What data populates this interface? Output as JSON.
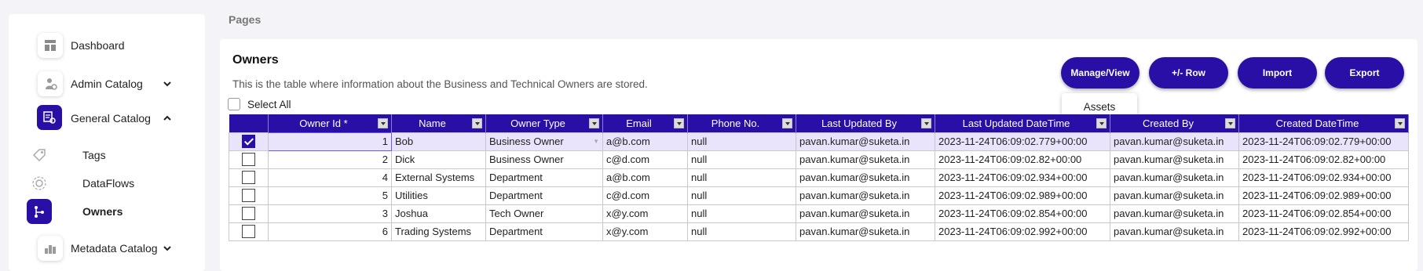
{
  "sidebar": {
    "items": [
      {
        "label": "Dashboard",
        "icon": "dashboard-icon"
      },
      {
        "label": "Admin Catalog",
        "icon": "admin-catalog-icon",
        "expand": "chevron-down-icon"
      },
      {
        "label": "General Catalog",
        "icon": "general-catalog-icon",
        "expand": "chevron-up-icon",
        "active": true
      },
      {
        "label": "Tags",
        "icon": "tag-icon"
      },
      {
        "label": "DataFlows",
        "icon": "dataflows-icon"
      },
      {
        "label": "Owners",
        "icon": "owners-icon",
        "active": true
      },
      {
        "label": "Metadata Catalog",
        "icon": "metadata-catalog-icon",
        "expand": "chevron-down-icon"
      }
    ]
  },
  "breadcrumb": "Pages",
  "page": {
    "title": "Owners",
    "description": "This is the table where information about the Business and Technical Owners are stored."
  },
  "toolbar": {
    "manage_view": "Manage/View",
    "row": "+/- Row",
    "import": "Import",
    "export": "Export",
    "dropdown_item": "Assets"
  },
  "select_all": "Select All",
  "table": {
    "columns": [
      "Owner Id *",
      "Name",
      "Owner Type",
      "Email",
      "Phone No.",
      "Last Updated By",
      "Last Updated DateTime",
      "Created By",
      "Created DateTime"
    ],
    "rows": [
      {
        "checked": true,
        "id": "1",
        "name": "Bob",
        "type": "Business Owner",
        "email": "a@b.com",
        "phone": "null",
        "updated_by": "pavan.kumar@suketa.in",
        "updated_at": "2023-11-24T06:09:02.779+00:00",
        "created_by": "pavan.kumar@suketa.in",
        "created_at": "2023-11-24T06:09:02.779+00:00"
      },
      {
        "checked": false,
        "id": "2",
        "name": "Dick",
        "type": "Business Owner",
        "email": "c@d.com",
        "phone": "null",
        "updated_by": "pavan.kumar@suketa.in",
        "updated_at": "2023-11-24T06:09:02.82+00:00",
        "created_by": "pavan.kumar@suketa.in",
        "created_at": "2023-11-24T06:09:02.82+00:00"
      },
      {
        "checked": false,
        "id": "4",
        "name": "External Systems",
        "type": "Department",
        "email": "a@b.com",
        "phone": "null",
        "updated_by": "pavan.kumar@suketa.in",
        "updated_at": "2023-11-24T06:09:02.934+00:00",
        "created_by": "pavan.kumar@suketa.in",
        "created_at": "2023-11-24T06:09:02.934+00:00"
      },
      {
        "checked": false,
        "id": "5",
        "name": "Utilities",
        "type": "Department",
        "email": "c@d.com",
        "phone": "null",
        "updated_by": "pavan.kumar@suketa.in",
        "updated_at": "2023-11-24T06:09:02.989+00:00",
        "created_by": "pavan.kumar@suketa.in",
        "created_at": "2023-11-24T06:09:02.989+00:00"
      },
      {
        "checked": false,
        "id": "3",
        "name": "Joshua",
        "type": "Tech Owner",
        "email": "x@y.com",
        "phone": "null",
        "updated_by": "pavan.kumar@suketa.in",
        "updated_at": "2023-11-24T06:09:02.854+00:00",
        "created_by": "pavan.kumar@suketa.in",
        "created_at": "2023-11-24T06:09:02.854+00:00"
      },
      {
        "checked": false,
        "id": "6",
        "name": "Trading Systems",
        "type": "Department",
        "email": "x@y.com",
        "phone": "null",
        "updated_by": "pavan.kumar@suketa.in",
        "updated_at": "2023-11-24T06:09:02.992+00:00",
        "created_by": "pavan.kumar@suketa.in",
        "created_at": "2023-11-24T06:09:02.992+00:00"
      }
    ]
  },
  "colors": {
    "accent": "#2a0fa6",
    "selected_row": "#e9e4fb"
  }
}
